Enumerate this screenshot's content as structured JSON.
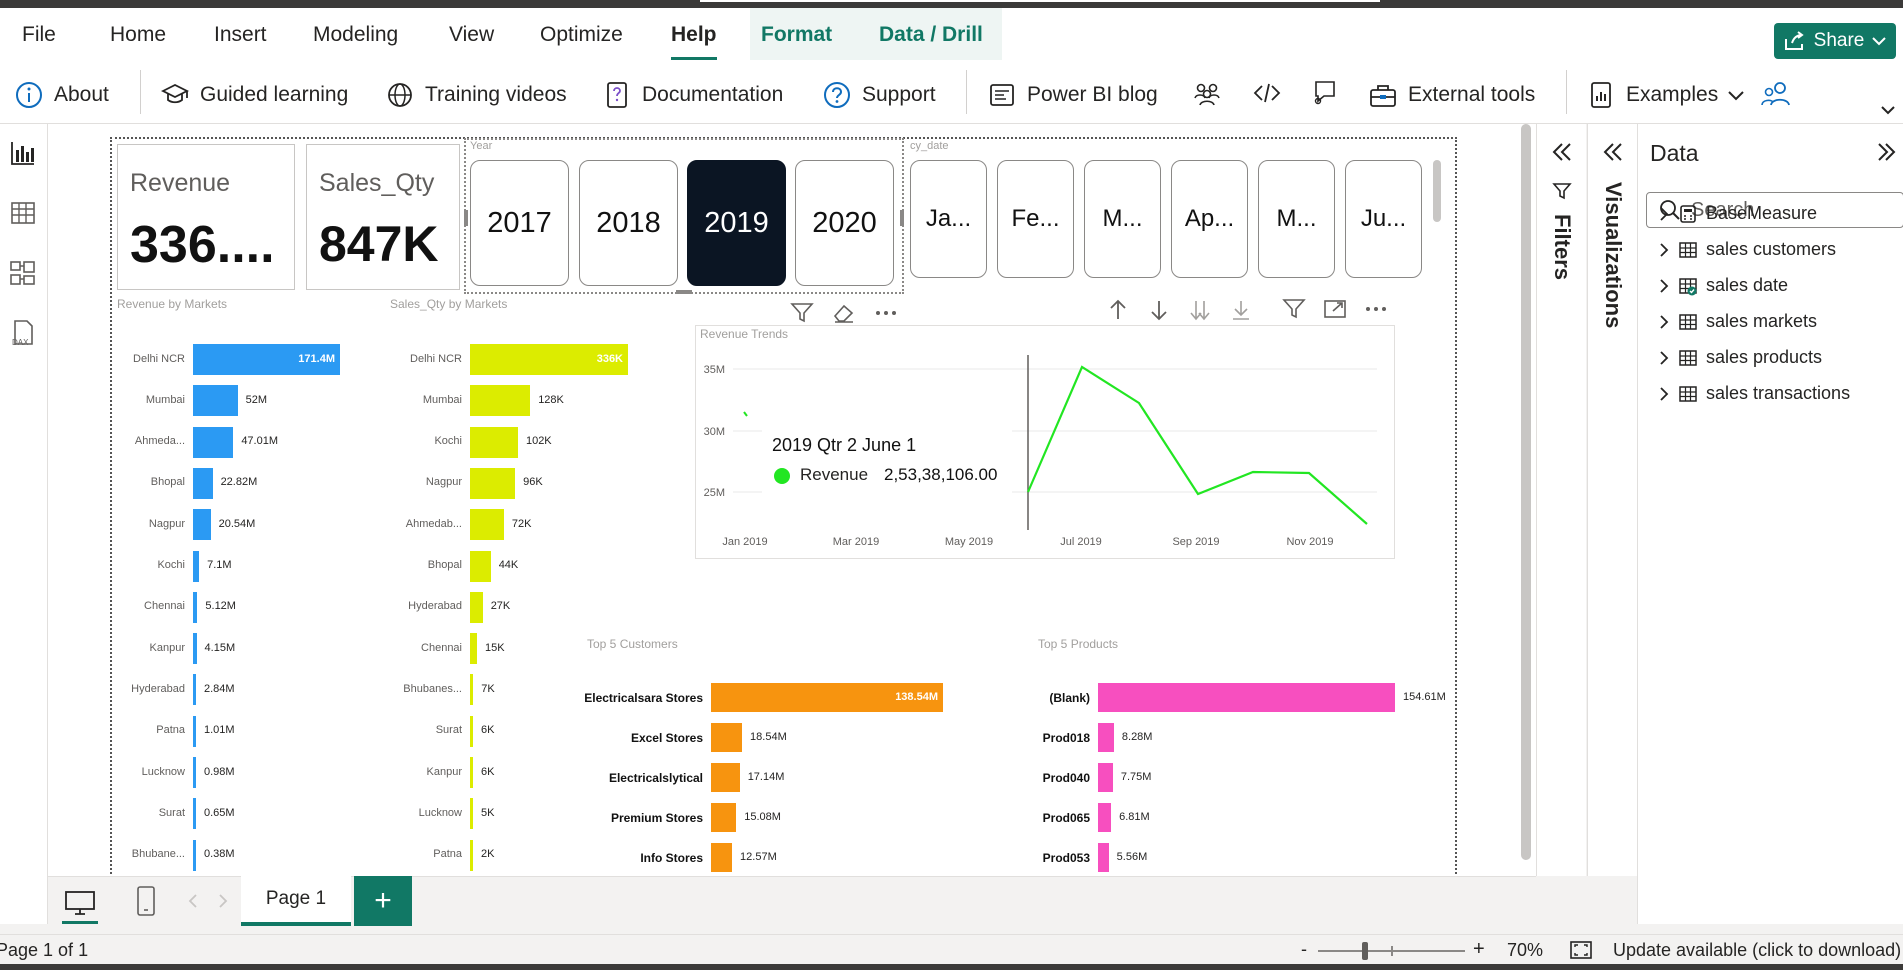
{
  "menu": {
    "items": [
      "File",
      "Home",
      "Insert",
      "Modeling",
      "View",
      "Optimize",
      "Help"
    ],
    "active": "Help",
    "contextual": [
      "Format",
      "Data / Drill"
    ],
    "share_label": "Share"
  },
  "ribbon": {
    "about": "About",
    "guided_learning": "Guided learning",
    "training_videos": "Training videos",
    "documentation": "Documentation",
    "support": "Support",
    "power_bi_blog": "Power BI blog",
    "external_tools": "External tools",
    "examples": "Examples"
  },
  "cards": {
    "revenue": {
      "label": "Revenue",
      "value": "336...."
    },
    "sales_qty": {
      "label": "Sales_Qty",
      "value": "847K"
    }
  },
  "year_slicer": {
    "title": "Year",
    "years": [
      "2017",
      "2018",
      "2019",
      "2020"
    ],
    "selected": "2019"
  },
  "month_slicer": {
    "title": "cy_date",
    "months": [
      "Ja...",
      "Fe...",
      "M...",
      "Ap...",
      "M...",
      "Ju..."
    ]
  },
  "revenue_by_markets": {
    "title": "Revenue by Markets",
    "rows": [
      {
        "label": "Delhi NCR",
        "value": 171.4,
        "display": "171.4M"
      },
      {
        "label": "Mumbai",
        "value": 52,
        "display": "52M"
      },
      {
        "label": "Ahmeda...",
        "value": 47.01,
        "display": "47.01M"
      },
      {
        "label": "Bhopal",
        "value": 22.82,
        "display": "22.82M"
      },
      {
        "label": "Nagpur",
        "value": 20.54,
        "display": "20.54M"
      },
      {
        "label": "Kochi",
        "value": 7.1,
        "display": "7.1M"
      },
      {
        "label": "Chennai",
        "value": 5.12,
        "display": "5.12M"
      },
      {
        "label": "Kanpur",
        "value": 4.15,
        "display": "4.15M"
      },
      {
        "label": "Hyderabad",
        "value": 2.84,
        "display": "2.84M"
      },
      {
        "label": "Patna",
        "value": 1.01,
        "display": "1.01M"
      },
      {
        "label": "Lucknow",
        "value": 0.98,
        "display": "0.98M"
      },
      {
        "label": "Surat",
        "value": 0.65,
        "display": "0.65M"
      },
      {
        "label": "Bhubane...",
        "value": 0.38,
        "display": "0.38M"
      }
    ],
    "color": "#2b9af3"
  },
  "sales_qty_by_markets": {
    "title": "Sales_Qty by Markets",
    "rows": [
      {
        "label": "Delhi NCR",
        "value": 336,
        "display": "336K"
      },
      {
        "label": "Mumbai",
        "value": 128,
        "display": "128K"
      },
      {
        "label": "Kochi",
        "value": 102,
        "display": "102K"
      },
      {
        "label": "Nagpur",
        "value": 96,
        "display": "96K"
      },
      {
        "label": "Ahmedab...",
        "value": 72,
        "display": "72K"
      },
      {
        "label": "Bhopal",
        "value": 44,
        "display": "44K"
      },
      {
        "label": "Hyderabad",
        "value": 27,
        "display": "27K"
      },
      {
        "label": "Chennai",
        "value": 15,
        "display": "15K"
      },
      {
        "label": "Bhubanes...",
        "value": 7,
        "display": "7K"
      },
      {
        "label": "Surat",
        "value": 6,
        "display": "6K"
      },
      {
        "label": "Kanpur",
        "value": 6,
        "display": "6K"
      },
      {
        "label": "Lucknow",
        "value": 5,
        "display": "5K"
      },
      {
        "label": "Patna",
        "value": 2,
        "display": "2K"
      }
    ],
    "color": "#dcec00"
  },
  "revenue_trends": {
    "title": "Revenue Trends",
    "y_ticks": [
      "35M",
      "30M",
      "25M"
    ],
    "x_ticks": [
      "Jan 2019",
      "Mar 2019",
      "May 2019",
      "Jul 2019",
      "Sep 2019",
      "Nov 2019"
    ],
    "tooltip": {
      "header": "2019 Qtr 2 June 1",
      "series": "Revenue",
      "value": "2,53,38,106.00"
    },
    "color": "#22e622"
  },
  "top_customers": {
    "title": "Top 5 Customers",
    "rows": [
      {
        "label": "Electricalsara Stores",
        "value": 138.54,
        "display": "138.54M"
      },
      {
        "label": "Excel Stores",
        "value": 18.54,
        "display": "18.54M"
      },
      {
        "label": "Electricalslytical",
        "value": 17.14,
        "display": "17.14M"
      },
      {
        "label": "Premium Stores",
        "value": 15.08,
        "display": "15.08M"
      },
      {
        "label": "Info Stores",
        "value": 12.57,
        "display": "12.57M"
      }
    ],
    "color": "#f7940f"
  },
  "top_products": {
    "title": "Top 5 Products",
    "rows": [
      {
        "label": "(Blank)",
        "value": 154.61,
        "display": "154.61M"
      },
      {
        "label": "Prod018",
        "value": 8.28,
        "display": "8.28M"
      },
      {
        "label": "Prod040",
        "value": 7.75,
        "display": "7.75M"
      },
      {
        "label": "Prod065",
        "value": 6.81,
        "display": "6.81M"
      },
      {
        "label": "Prod053",
        "value": 5.56,
        "display": "5.56M"
      }
    ],
    "color": "#f74fbf"
  },
  "panes": {
    "filters": "Filters",
    "visualizations": "Visualizations",
    "data_title": "Data",
    "search_placeholder": "Search",
    "tables": [
      "BaseMeasure",
      "sales customers",
      "sales date",
      "sales markets",
      "sales products",
      "sales transactions"
    ]
  },
  "pages": {
    "tab": "Page 1",
    "add": "+"
  },
  "status": {
    "page": "Page 1 of 1",
    "zoom": "70%",
    "zoom_minus": "-",
    "zoom_plus": "+",
    "update": "Update available (click to download)"
  }
}
